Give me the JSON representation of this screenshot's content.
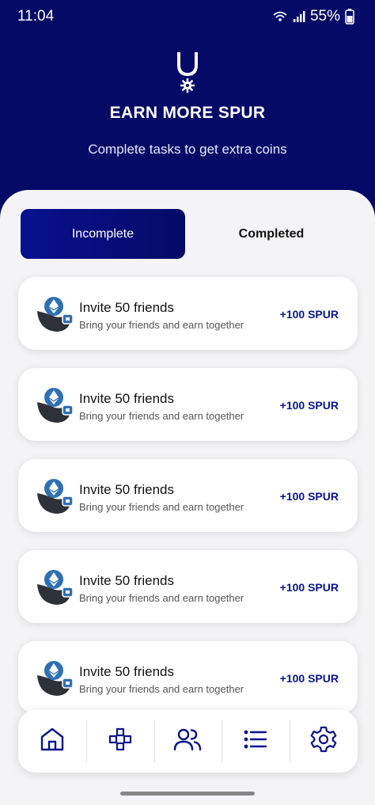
{
  "status": {
    "time": "11:04",
    "battery": "55%",
    "icons": [
      "wifi-calling-icon",
      "signal-icon",
      "battery-icon"
    ]
  },
  "header": {
    "logo_icon": "magnet-gear-logo",
    "title": "EARN MORE SPUR",
    "subtitle": "Complete tasks to get extra coins"
  },
  "tabs": [
    {
      "label": "Incomplete",
      "active": true
    },
    {
      "label": "Completed",
      "active": false
    }
  ],
  "tasks": [
    {
      "title": "Invite 50 friends",
      "description": "Bring your friends and earn together",
      "reward": "+100 SPUR"
    },
    {
      "title": "Invite 50 friends",
      "description": "Bring your friends and earn together",
      "reward": "+100 SPUR"
    },
    {
      "title": "Invite 50 friends",
      "description": "Bring your friends and earn together",
      "reward": "+100 SPUR"
    },
    {
      "title": "Invite 50 friends",
      "description": "Bring your friends and earn together",
      "reward": "+100 SPUR"
    },
    {
      "title": "Invite 50 friends",
      "description": "Bring your friends and earn together",
      "reward": "+100 SPUR"
    }
  ],
  "nav": [
    {
      "icon": "home-icon",
      "active": false
    },
    {
      "icon": "gamepad-icon",
      "active": false
    },
    {
      "icon": "users-icon",
      "active": false
    },
    {
      "icon": "list-icon",
      "active": true
    },
    {
      "icon": "gear-icon",
      "active": false
    }
  ],
  "colors": {
    "brand_navy": "#050a66",
    "accent_blue": "#0b148a",
    "reward_text": "#0b148a",
    "background": "#f4f4f6"
  }
}
